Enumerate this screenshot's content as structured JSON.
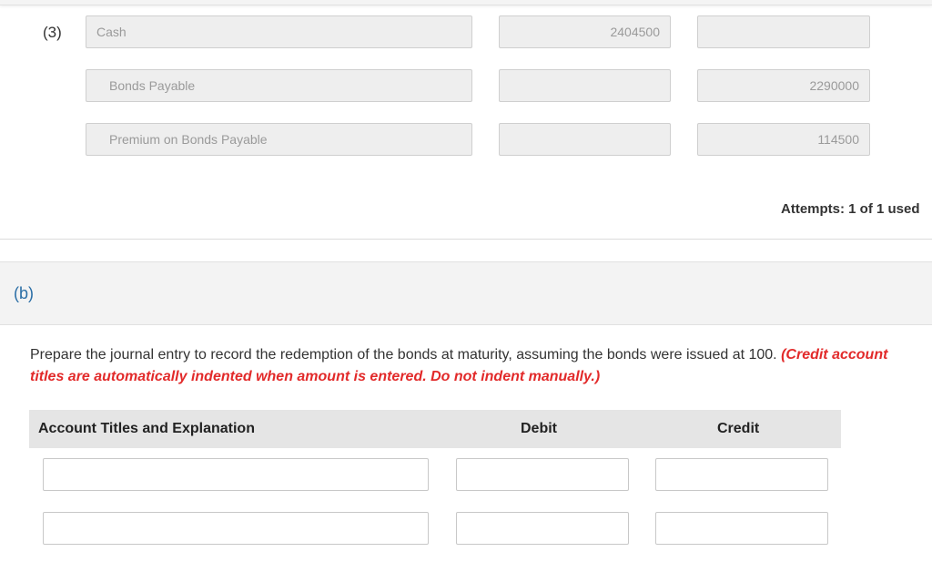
{
  "part_a": {
    "row_label": "(3)",
    "entries": [
      {
        "account": "Cash",
        "debit": "2404500",
        "credit": "",
        "indented": false
      },
      {
        "account": "Bonds Payable",
        "debit": "",
        "credit": "2290000",
        "indented": true
      },
      {
        "account": "Premium on Bonds Payable",
        "debit": "",
        "credit": "114500",
        "indented": true
      }
    ],
    "attempts": "Attempts: 1 of 1 used"
  },
  "part_b": {
    "label": "(b)",
    "instructions": "Prepare the journal entry to record the redemption of the bonds at maturity, assuming the bonds were issued at 100.",
    "note": "(Credit account titles are automatically indented when amount is entered. Do not indent manually.)",
    "table": {
      "headers": {
        "account": "Account Titles and Explanation",
        "debit": "Debit",
        "credit": "Credit"
      },
      "rows": [
        {
          "account": "",
          "debit": "",
          "credit": ""
        },
        {
          "account": "",
          "debit": "",
          "credit": ""
        }
      ]
    }
  },
  "colors": {
    "part_label": "#2a6ea6",
    "note_red": "#e22a2a",
    "header_bg": "#e5e5e5",
    "disabled_field_bg": "#eeeeee"
  }
}
